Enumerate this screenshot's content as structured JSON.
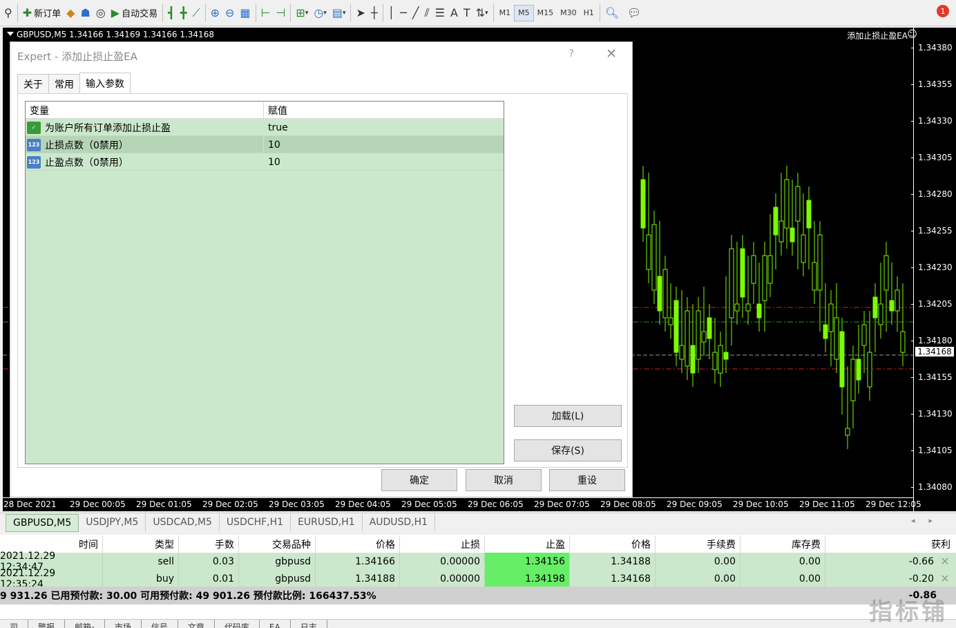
{
  "toolbar": {
    "new_order": "新订单",
    "auto_trading": "自动交易",
    "timeframes": [
      "M1",
      "M5",
      "M15",
      "M30",
      "H1"
    ],
    "active_timeframe": "M5",
    "notification_count": "1"
  },
  "chart": {
    "title": "GBPUSD,M5  1.34166 1.34169 1.34166 1.34168",
    "ea_label": "添加止损止盈EA",
    "current_price": "1.34168",
    "prices": [
      "1.34380",
      "1.34355",
      "1.34330",
      "1.34305",
      "1.34280",
      "1.34255",
      "1.34230",
      "1.34205",
      "1.34180",
      "1.34155",
      "1.34130",
      "1.34105",
      "1.34080"
    ],
    "times": [
      "28 Dec 2021",
      "29 Dec 00:05",
      "29 Dec 01:05",
      "29 Dec 02:05",
      "29 Dec 03:05",
      "29 Dec 04:05",
      "29 Dec 05:05",
      "29 Dec 06:05",
      "29 Dec 07:05",
      "29 Dec 08:05",
      "29 Dec 09:05",
      "29 Dec 10:05",
      "29 Dec 11:05",
      "29 Dec 12:05"
    ],
    "colors": {
      "candle": "#7cfc00",
      "sl_line": "#d02020",
      "tp_line": "#20a020"
    }
  },
  "dialog": {
    "title": "Expert - 添加止损止盈EA",
    "help": "?",
    "tabs": [
      "关于",
      "常用",
      "输入参数"
    ],
    "active_tab": "输入参数",
    "grid_headers": {
      "variable": "变量",
      "value": "赋值"
    },
    "params": [
      {
        "name": "为账户所有订单添加止损止盈",
        "value": "true",
        "icon": "bool-icon"
      },
      {
        "name": "止损点数（0禁用）",
        "value": "10",
        "icon": "number-123-icon"
      },
      {
        "name": "止盈点数（0禁用）",
        "value": "10",
        "icon": "number-123-icon"
      }
    ],
    "load_label": "加载(L)",
    "save_label": "保存(S)",
    "ok_label": "确定",
    "cancel_label": "取消",
    "reset_label": "重设"
  },
  "symbol_tabs": [
    "GBPUSD,M5",
    "USDJPY,M5",
    "USDCAD,M5",
    "USDCHF,H1",
    "EURUSD,H1",
    "AUDUSD,H1"
  ],
  "active_symbol": "GBPUSD,M5",
  "orders": {
    "headers": [
      "时间",
      "类型",
      "手数",
      "交易品种",
      "价格",
      "止损",
      "止盈",
      "价格",
      "手续费",
      "库存费",
      "获利"
    ],
    "rows": [
      [
        "2021.12.29 12:34:47",
        "sell",
        "0.03",
        "gbpusd",
        "1.34166",
        "0.00000",
        "1.34156",
        "1.34188",
        "0.00",
        "0.00",
        "-0.66"
      ],
      [
        "2021.12.29 12:35:24",
        "buy",
        "0.01",
        "gbpusd",
        "1.34188",
        "0.00000",
        "1.34198",
        "1.34168",
        "0.00",
        "0.00",
        "-0.20"
      ]
    ],
    "summary": "9 931.26  已用预付款: 30.00  可用预付款: 49 901.26  预付款比例: 166437.53%",
    "total": "-0.86"
  },
  "terminal_tabs": [
    "司",
    "警报",
    "邮箱₂",
    "市场",
    "信号",
    "文章",
    "代码库",
    "EA",
    "日志"
  ],
  "watermark": "指标铺"
}
